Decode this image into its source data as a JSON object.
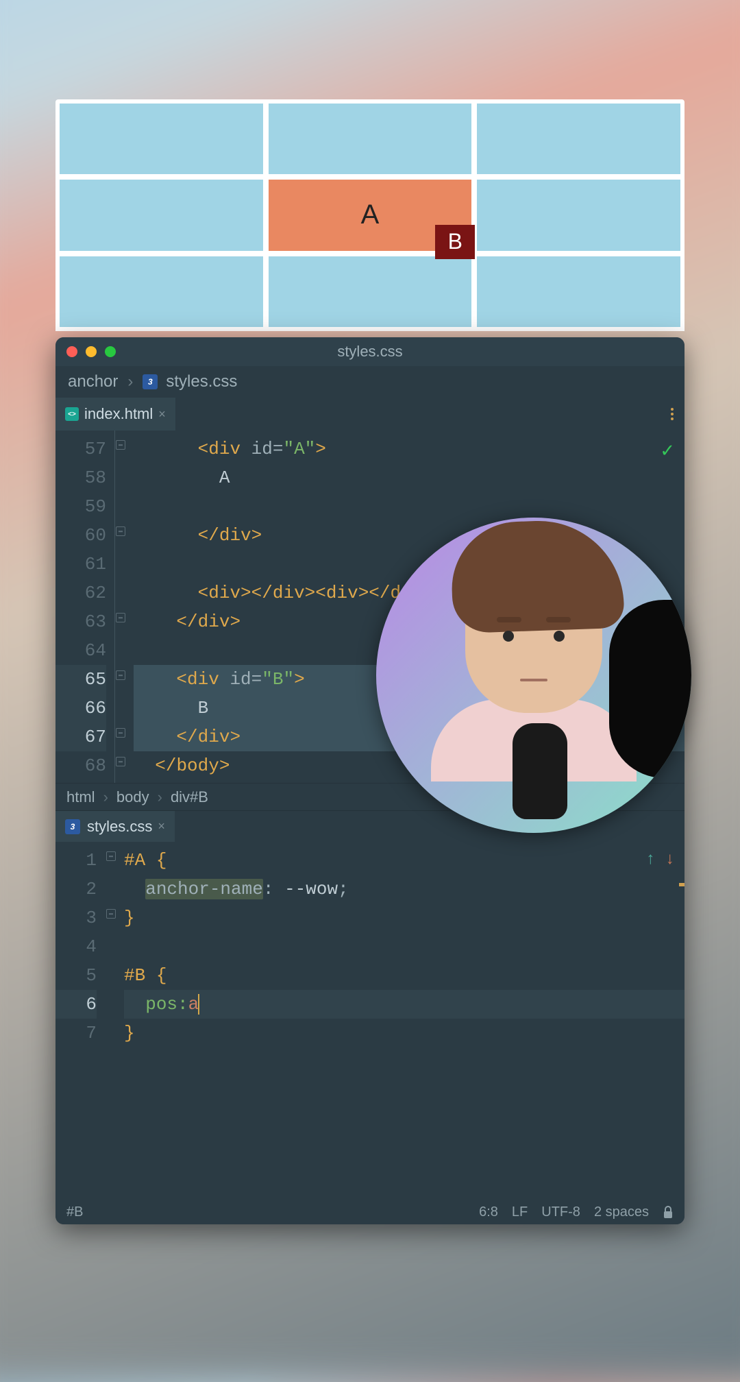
{
  "preview": {
    "a_label": "A",
    "b_label": "B"
  },
  "editor": {
    "title": "styles.css",
    "breadcrumb": {
      "project": "anchor",
      "file": "styles.css"
    },
    "top_tab": {
      "name": "index.html"
    },
    "bottom_tab": {
      "name": "styles.css"
    },
    "kebab_title": "More"
  },
  "html_pane": {
    "lines": {
      "57": {
        "raw": "      <div id=\"A\">"
      },
      "58": {
        "raw": "        A"
      },
      "59": {
        "raw": ""
      },
      "60": {
        "raw": "      </div>"
      },
      "61": {
        "raw": ""
      },
      "62": {
        "raw": "      <div></div><div></div><di"
      },
      "63": {
        "raw": "    </div>"
      },
      "64": {
        "raw": ""
      },
      "65": {
        "raw": "    <div id=\"B\">"
      },
      "66": {
        "raw": "      B"
      },
      "67": {
        "raw": "    </div>"
      },
      "68": {
        "raw": "  </body>"
      }
    },
    "subcrumb": [
      "html",
      "body",
      "div#B"
    ]
  },
  "css_pane": {
    "lines": {
      "1": {
        "sel": "#A",
        "brace": "{"
      },
      "2": {
        "prop": "anchor-name",
        "val": "--wow",
        "semi": ";"
      },
      "3": {
        "brace": "}"
      },
      "4": {
        "blank": true
      },
      "5": {
        "sel": "#B",
        "brace": "{"
      },
      "6": {
        "emmet_a": "pos:",
        "emmet_b": "a"
      },
      "7": {
        "brace": "}"
      }
    }
  },
  "status": {
    "left": "#B",
    "pos": "6:8",
    "eol": "LF",
    "enc": "UTF-8",
    "indent": "2 spaces"
  }
}
